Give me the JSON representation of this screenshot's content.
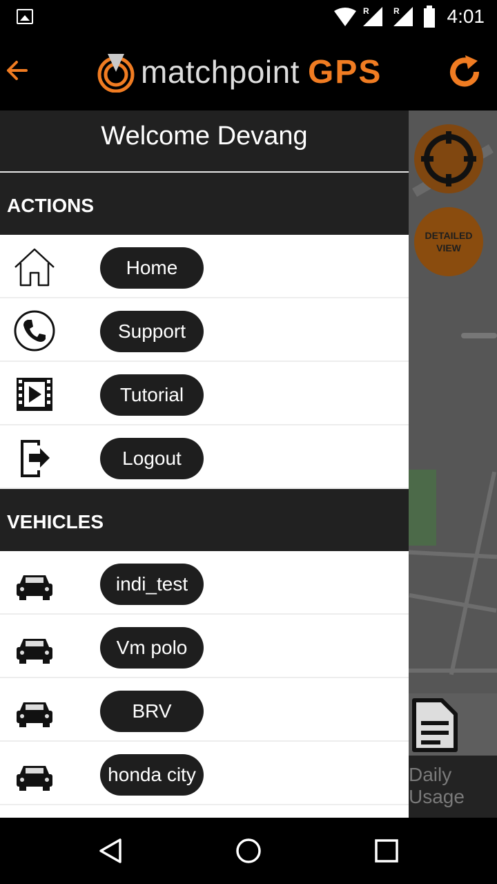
{
  "status_bar": {
    "time": "4:01"
  },
  "header": {
    "logo_text": "matchpoint",
    "logo_accent": "GPS",
    "accent_color": "#f07c22",
    "back_icon": "arrow-left-icon",
    "refresh_icon": "refresh-icon"
  },
  "drawer": {
    "welcome": "Welcome Devang",
    "actions_title": "ACTIONS",
    "actions": [
      {
        "label": "Home",
        "icon": "home-icon"
      },
      {
        "label": "Support",
        "icon": "phone-icon"
      },
      {
        "label": "Tutorial",
        "icon": "video-icon"
      },
      {
        "label": "Logout",
        "icon": "logout-icon"
      }
    ],
    "vehicles_title": "VEHICLES",
    "vehicles": [
      {
        "label": "indi_test",
        "icon": "car-icon"
      },
      {
        "label": "Vm polo",
        "icon": "car-icon"
      },
      {
        "label": "BRV",
        "icon": "car-icon"
      },
      {
        "label": "honda city",
        "icon": "car-icon"
      }
    ]
  },
  "map": {
    "detail_button": "DETAILED VIEW",
    "daily_usage": "Daily Usage"
  }
}
